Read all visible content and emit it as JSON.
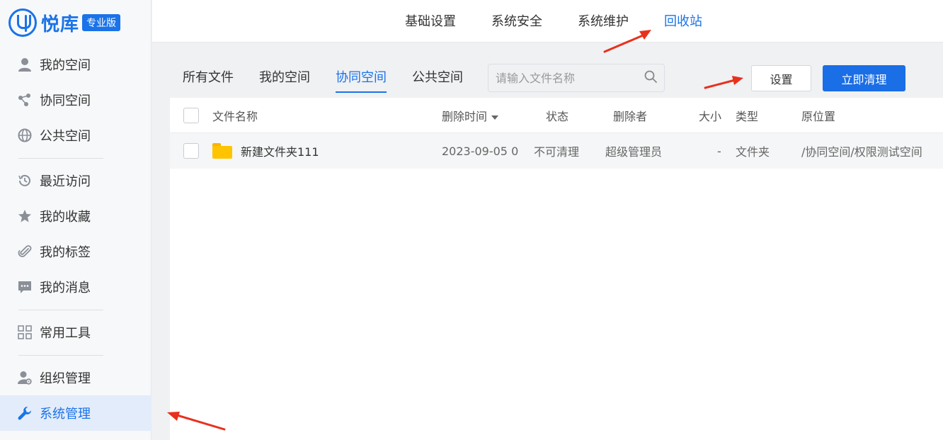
{
  "app": {
    "logo_text": "悦库",
    "edition_badge": "专业版"
  },
  "sidebar": {
    "items": [
      {
        "label": "我的空间",
        "icon": "user-icon"
      },
      {
        "label": "协同空间",
        "icon": "share-icon"
      },
      {
        "label": "公共空间",
        "icon": "globe-icon"
      },
      {
        "label": "最近访问",
        "icon": "history-icon"
      },
      {
        "label": "我的收藏",
        "icon": "star-icon"
      },
      {
        "label": "我的标签",
        "icon": "paperclip-icon"
      },
      {
        "label": "我的消息",
        "icon": "message-icon"
      },
      {
        "label": "常用工具",
        "icon": "grid-icon"
      },
      {
        "label": "组织管理",
        "icon": "org-user-gear-icon"
      },
      {
        "label": "系统管理",
        "icon": "wrench-icon",
        "active": true
      }
    ]
  },
  "topnav": {
    "items": [
      "基础设置",
      "系统安全",
      "系统维护",
      "回收站"
    ],
    "active": "回收站"
  },
  "tabs": {
    "items": [
      "所有文件",
      "我的空间",
      "协同空间",
      "公共空间"
    ],
    "active": "协同空间"
  },
  "search": {
    "placeholder": "请输入文件名称"
  },
  "buttons": {
    "settings": "设置",
    "clean_now": "立即清理"
  },
  "table": {
    "headers": {
      "name": "文件名称",
      "deleted_time": "删除时间",
      "status": "状态",
      "deleted_by": "删除者",
      "size": "大小",
      "type": "类型",
      "original_location": "原位置"
    },
    "rows": [
      {
        "name": "新建文件夹111",
        "deleted_time": "2023-09-05 0",
        "status": "不可清理",
        "deleted_by": "超级管理员",
        "size": "-",
        "type": "文件夹",
        "original_location": "/协同空间/权限测试空间"
      }
    ]
  },
  "colors": {
    "accent": "#1a73e8",
    "annotation_arrow": "#e8301c"
  }
}
